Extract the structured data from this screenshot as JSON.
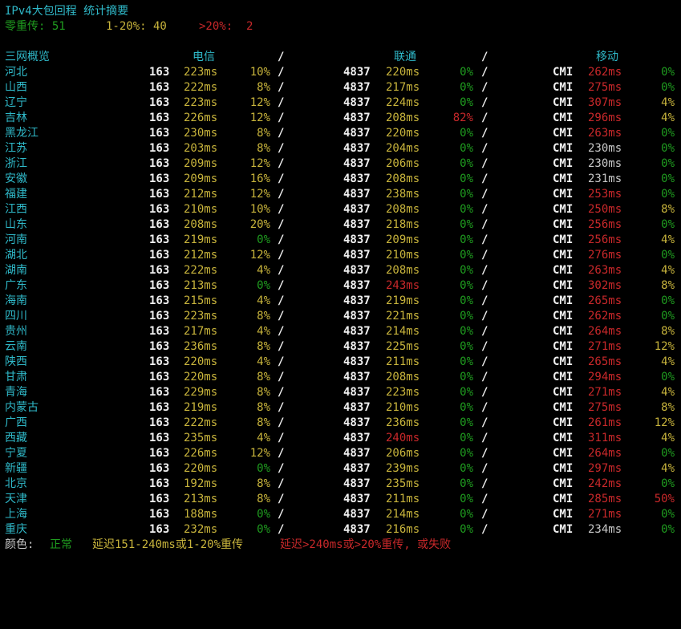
{
  "summary": {
    "title": "IPv4大包回程 统计摘要",
    "zero_label": "零重传: 51",
    "mid_label": "1-20%: 40",
    "high_label": ">20%:  2"
  },
  "header": {
    "overview": "三网概览",
    "telecom": "电信",
    "unicom": "联通",
    "mobile": "移动",
    "separator": "/"
  },
  "rows": [
    {
      "prov": "河北",
      "ct_asn": "163",
      "ct_lat": "223ms",
      "ct_lat_c": "y",
      "ct_loss": "10%",
      "ct_loss_c": "y",
      "cu_asn": "4837",
      "cu_lat": "220ms",
      "cu_lat_c": "y",
      "cu_loss": "0%",
      "cu_loss_c": "g",
      "cm_asn": "CMI",
      "cm_lat": "262ms",
      "cm_lat_c": "r",
      "cm_loss": "0%",
      "cm_loss_c": "g"
    },
    {
      "prov": "山西",
      "ct_asn": "163",
      "ct_lat": "222ms",
      "ct_lat_c": "y",
      "ct_loss": "8%",
      "ct_loss_c": "y",
      "cu_asn": "4837",
      "cu_lat": "217ms",
      "cu_lat_c": "y",
      "cu_loss": "0%",
      "cu_loss_c": "g",
      "cm_asn": "CMI",
      "cm_lat": "275ms",
      "cm_lat_c": "r",
      "cm_loss": "0%",
      "cm_loss_c": "g"
    },
    {
      "prov": "辽宁",
      "ct_asn": "163",
      "ct_lat": "223ms",
      "ct_lat_c": "y",
      "ct_loss": "12%",
      "ct_loss_c": "y",
      "cu_asn": "4837",
      "cu_lat": "224ms",
      "cu_lat_c": "y",
      "cu_loss": "0%",
      "cu_loss_c": "g",
      "cm_asn": "CMI",
      "cm_lat": "307ms",
      "cm_lat_c": "r",
      "cm_loss": "4%",
      "cm_loss_c": "y"
    },
    {
      "prov": "吉林",
      "ct_asn": "163",
      "ct_lat": "226ms",
      "ct_lat_c": "y",
      "ct_loss": "12%",
      "ct_loss_c": "y",
      "cu_asn": "4837",
      "cu_lat": "208ms",
      "cu_lat_c": "y",
      "cu_loss": "82%",
      "cu_loss_c": "r",
      "cm_asn": "CMI",
      "cm_lat": "296ms",
      "cm_lat_c": "r",
      "cm_loss": "4%",
      "cm_loss_c": "y"
    },
    {
      "prov": "黑龙江",
      "ct_asn": "163",
      "ct_lat": "230ms",
      "ct_lat_c": "y",
      "ct_loss": "8%",
      "ct_loss_c": "y",
      "cu_asn": "4837",
      "cu_lat": "220ms",
      "cu_lat_c": "y",
      "cu_loss": "0%",
      "cu_loss_c": "g",
      "cm_asn": "CMI",
      "cm_lat": "263ms",
      "cm_lat_c": "r",
      "cm_loss": "0%",
      "cm_loss_c": "g"
    },
    {
      "prov": "江苏",
      "ct_asn": "163",
      "ct_lat": "203ms",
      "ct_lat_c": "y",
      "ct_loss": "8%",
      "ct_loss_c": "y",
      "cu_asn": "4837",
      "cu_lat": "204ms",
      "cu_lat_c": "y",
      "cu_loss": "0%",
      "cu_loss_c": "g",
      "cm_asn": "CMI",
      "cm_lat": "230ms",
      "cm_lat_c": "p",
      "cm_loss": "0%",
      "cm_loss_c": "g"
    },
    {
      "prov": "浙江",
      "ct_asn": "163",
      "ct_lat": "209ms",
      "ct_lat_c": "y",
      "ct_loss": "12%",
      "ct_loss_c": "y",
      "cu_asn": "4837",
      "cu_lat": "206ms",
      "cu_lat_c": "y",
      "cu_loss": "0%",
      "cu_loss_c": "g",
      "cm_asn": "CMI",
      "cm_lat": "230ms",
      "cm_lat_c": "p",
      "cm_loss": "0%",
      "cm_loss_c": "g"
    },
    {
      "prov": "安徽",
      "ct_asn": "163",
      "ct_lat": "209ms",
      "ct_lat_c": "y",
      "ct_loss": "16%",
      "ct_loss_c": "y",
      "cu_asn": "4837",
      "cu_lat": "208ms",
      "cu_lat_c": "y",
      "cu_loss": "0%",
      "cu_loss_c": "g",
      "cm_asn": "CMI",
      "cm_lat": "231ms",
      "cm_lat_c": "p",
      "cm_loss": "0%",
      "cm_loss_c": "g"
    },
    {
      "prov": "福建",
      "ct_asn": "163",
      "ct_lat": "212ms",
      "ct_lat_c": "y",
      "ct_loss": "12%",
      "ct_loss_c": "y",
      "cu_asn": "4837",
      "cu_lat": "238ms",
      "cu_lat_c": "y",
      "cu_loss": "0%",
      "cu_loss_c": "g",
      "cm_asn": "CMI",
      "cm_lat": "253ms",
      "cm_lat_c": "r",
      "cm_loss": "0%",
      "cm_loss_c": "g"
    },
    {
      "prov": "江西",
      "ct_asn": "163",
      "ct_lat": "210ms",
      "ct_lat_c": "y",
      "ct_loss": "10%",
      "ct_loss_c": "y",
      "cu_asn": "4837",
      "cu_lat": "208ms",
      "cu_lat_c": "y",
      "cu_loss": "0%",
      "cu_loss_c": "g",
      "cm_asn": "CMI",
      "cm_lat": "250ms",
      "cm_lat_c": "r",
      "cm_loss": "8%",
      "cm_loss_c": "y"
    },
    {
      "prov": "山东",
      "ct_asn": "163",
      "ct_lat": "208ms",
      "ct_lat_c": "y",
      "ct_loss": "20%",
      "ct_loss_c": "y",
      "cu_asn": "4837",
      "cu_lat": "218ms",
      "cu_lat_c": "y",
      "cu_loss": "0%",
      "cu_loss_c": "g",
      "cm_asn": "CMI",
      "cm_lat": "256ms",
      "cm_lat_c": "r",
      "cm_loss": "0%",
      "cm_loss_c": "g"
    },
    {
      "prov": "河南",
      "ct_asn": "163",
      "ct_lat": "219ms",
      "ct_lat_c": "y",
      "ct_loss": "0%",
      "ct_loss_c": "g",
      "cu_asn": "4837",
      "cu_lat": "209ms",
      "cu_lat_c": "y",
      "cu_loss": "0%",
      "cu_loss_c": "g",
      "cm_asn": "CMI",
      "cm_lat": "256ms",
      "cm_lat_c": "r",
      "cm_loss": "4%",
      "cm_loss_c": "y"
    },
    {
      "prov": "湖北",
      "ct_asn": "163",
      "ct_lat": "212ms",
      "ct_lat_c": "y",
      "ct_loss": "12%",
      "ct_loss_c": "y",
      "cu_asn": "4837",
      "cu_lat": "210ms",
      "cu_lat_c": "y",
      "cu_loss": "0%",
      "cu_loss_c": "g",
      "cm_asn": "CMI",
      "cm_lat": "276ms",
      "cm_lat_c": "r",
      "cm_loss": "0%",
      "cm_loss_c": "g"
    },
    {
      "prov": "湖南",
      "ct_asn": "163",
      "ct_lat": "222ms",
      "ct_lat_c": "y",
      "ct_loss": "4%",
      "ct_loss_c": "y",
      "cu_asn": "4837",
      "cu_lat": "208ms",
      "cu_lat_c": "y",
      "cu_loss": "0%",
      "cu_loss_c": "g",
      "cm_asn": "CMI",
      "cm_lat": "263ms",
      "cm_lat_c": "r",
      "cm_loss": "4%",
      "cm_loss_c": "y"
    },
    {
      "prov": "广东",
      "ct_asn": "163",
      "ct_lat": "213ms",
      "ct_lat_c": "y",
      "ct_loss": "0%",
      "ct_loss_c": "g",
      "cu_asn": "4837",
      "cu_lat": "243ms",
      "cu_lat_c": "r",
      "cu_loss": "0%",
      "cu_loss_c": "g",
      "cm_asn": "CMI",
      "cm_lat": "302ms",
      "cm_lat_c": "r",
      "cm_loss": "8%",
      "cm_loss_c": "y"
    },
    {
      "prov": "海南",
      "ct_asn": "163",
      "ct_lat": "215ms",
      "ct_lat_c": "y",
      "ct_loss": "4%",
      "ct_loss_c": "y",
      "cu_asn": "4837",
      "cu_lat": "219ms",
      "cu_lat_c": "y",
      "cu_loss": "0%",
      "cu_loss_c": "g",
      "cm_asn": "CMI",
      "cm_lat": "265ms",
      "cm_lat_c": "r",
      "cm_loss": "0%",
      "cm_loss_c": "g"
    },
    {
      "prov": "四川",
      "ct_asn": "163",
      "ct_lat": "223ms",
      "ct_lat_c": "y",
      "ct_loss": "8%",
      "ct_loss_c": "y",
      "cu_asn": "4837",
      "cu_lat": "221ms",
      "cu_lat_c": "y",
      "cu_loss": "0%",
      "cu_loss_c": "g",
      "cm_asn": "CMI",
      "cm_lat": "262ms",
      "cm_lat_c": "r",
      "cm_loss": "0%",
      "cm_loss_c": "g"
    },
    {
      "prov": "贵州",
      "ct_asn": "163",
      "ct_lat": "217ms",
      "ct_lat_c": "y",
      "ct_loss": "4%",
      "ct_loss_c": "y",
      "cu_asn": "4837",
      "cu_lat": "214ms",
      "cu_lat_c": "y",
      "cu_loss": "0%",
      "cu_loss_c": "g",
      "cm_asn": "CMI",
      "cm_lat": "264ms",
      "cm_lat_c": "r",
      "cm_loss": "8%",
      "cm_loss_c": "y"
    },
    {
      "prov": "云南",
      "ct_asn": "163",
      "ct_lat": "236ms",
      "ct_lat_c": "y",
      "ct_loss": "8%",
      "ct_loss_c": "y",
      "cu_asn": "4837",
      "cu_lat": "225ms",
      "cu_lat_c": "y",
      "cu_loss": "0%",
      "cu_loss_c": "g",
      "cm_asn": "CMI",
      "cm_lat": "271ms",
      "cm_lat_c": "r",
      "cm_loss": "12%",
      "cm_loss_c": "y"
    },
    {
      "prov": "陕西",
      "ct_asn": "163",
      "ct_lat": "220ms",
      "ct_lat_c": "y",
      "ct_loss": "4%",
      "ct_loss_c": "y",
      "cu_asn": "4837",
      "cu_lat": "211ms",
      "cu_lat_c": "y",
      "cu_loss": "0%",
      "cu_loss_c": "g",
      "cm_asn": "CMI",
      "cm_lat": "265ms",
      "cm_lat_c": "r",
      "cm_loss": "4%",
      "cm_loss_c": "y"
    },
    {
      "prov": "甘肃",
      "ct_asn": "163",
      "ct_lat": "220ms",
      "ct_lat_c": "y",
      "ct_loss": "8%",
      "ct_loss_c": "y",
      "cu_asn": "4837",
      "cu_lat": "208ms",
      "cu_lat_c": "y",
      "cu_loss": "0%",
      "cu_loss_c": "g",
      "cm_asn": "CMI",
      "cm_lat": "294ms",
      "cm_lat_c": "r",
      "cm_loss": "0%",
      "cm_loss_c": "g"
    },
    {
      "prov": "青海",
      "ct_asn": "163",
      "ct_lat": "229ms",
      "ct_lat_c": "y",
      "ct_loss": "8%",
      "ct_loss_c": "y",
      "cu_asn": "4837",
      "cu_lat": "223ms",
      "cu_lat_c": "y",
      "cu_loss": "0%",
      "cu_loss_c": "g",
      "cm_asn": "CMI",
      "cm_lat": "271ms",
      "cm_lat_c": "r",
      "cm_loss": "4%",
      "cm_loss_c": "y"
    },
    {
      "prov": "内蒙古",
      "ct_asn": "163",
      "ct_lat": "219ms",
      "ct_lat_c": "y",
      "ct_loss": "8%",
      "ct_loss_c": "y",
      "cu_asn": "4837",
      "cu_lat": "210ms",
      "cu_lat_c": "y",
      "cu_loss": "0%",
      "cu_loss_c": "g",
      "cm_asn": "CMI",
      "cm_lat": "275ms",
      "cm_lat_c": "r",
      "cm_loss": "8%",
      "cm_loss_c": "y"
    },
    {
      "prov": "广西",
      "ct_asn": "163",
      "ct_lat": "222ms",
      "ct_lat_c": "y",
      "ct_loss": "8%",
      "ct_loss_c": "y",
      "cu_asn": "4837",
      "cu_lat": "236ms",
      "cu_lat_c": "y",
      "cu_loss": "0%",
      "cu_loss_c": "g",
      "cm_asn": "CMI",
      "cm_lat": "261ms",
      "cm_lat_c": "r",
      "cm_loss": "12%",
      "cm_loss_c": "y"
    },
    {
      "prov": "西藏",
      "ct_asn": "163",
      "ct_lat": "235ms",
      "ct_lat_c": "y",
      "ct_loss": "4%",
      "ct_loss_c": "y",
      "cu_asn": "4837",
      "cu_lat": "240ms",
      "cu_lat_c": "r",
      "cu_loss": "0%",
      "cu_loss_c": "g",
      "cm_asn": "CMI",
      "cm_lat": "311ms",
      "cm_lat_c": "r",
      "cm_loss": "4%",
      "cm_loss_c": "y"
    },
    {
      "prov": "宁夏",
      "ct_asn": "163",
      "ct_lat": "226ms",
      "ct_lat_c": "y",
      "ct_loss": "12%",
      "ct_loss_c": "y",
      "cu_asn": "4837",
      "cu_lat": "206ms",
      "cu_lat_c": "y",
      "cu_loss": "0%",
      "cu_loss_c": "g",
      "cm_asn": "CMI",
      "cm_lat": "264ms",
      "cm_lat_c": "r",
      "cm_loss": "0%",
      "cm_loss_c": "g"
    },
    {
      "prov": "新疆",
      "ct_asn": "163",
      "ct_lat": "220ms",
      "ct_lat_c": "y",
      "ct_loss": "0%",
      "ct_loss_c": "g",
      "cu_asn": "4837",
      "cu_lat": "239ms",
      "cu_lat_c": "y",
      "cu_loss": "0%",
      "cu_loss_c": "g",
      "cm_asn": "CMI",
      "cm_lat": "297ms",
      "cm_lat_c": "r",
      "cm_loss": "4%",
      "cm_loss_c": "y"
    },
    {
      "prov": "北京",
      "ct_asn": "163",
      "ct_lat": "192ms",
      "ct_lat_c": "y",
      "ct_loss": "8%",
      "ct_loss_c": "y",
      "cu_asn": "4837",
      "cu_lat": "235ms",
      "cu_lat_c": "y",
      "cu_loss": "0%",
      "cu_loss_c": "g",
      "cm_asn": "CMI",
      "cm_lat": "242ms",
      "cm_lat_c": "r",
      "cm_loss": "0%",
      "cm_loss_c": "g"
    },
    {
      "prov": "天津",
      "ct_asn": "163",
      "ct_lat": "213ms",
      "ct_lat_c": "y",
      "ct_loss": "8%",
      "ct_loss_c": "y",
      "cu_asn": "4837",
      "cu_lat": "211ms",
      "cu_lat_c": "y",
      "cu_loss": "0%",
      "cu_loss_c": "g",
      "cm_asn": "CMI",
      "cm_lat": "285ms",
      "cm_lat_c": "r",
      "cm_loss": "50%",
      "cm_loss_c": "r"
    },
    {
      "prov": "上海",
      "ct_asn": "163",
      "ct_lat": "188ms",
      "ct_lat_c": "y",
      "ct_loss": "0%",
      "ct_loss_c": "g",
      "cu_asn": "4837",
      "cu_lat": "214ms",
      "cu_lat_c": "y",
      "cu_loss": "0%",
      "cu_loss_c": "g",
      "cm_asn": "CMI",
      "cm_lat": "271ms",
      "cm_lat_c": "r",
      "cm_loss": "0%",
      "cm_loss_c": "g"
    },
    {
      "prov": "重庆",
      "ct_asn": "163",
      "ct_lat": "232ms",
      "ct_lat_c": "y",
      "ct_loss": "0%",
      "ct_loss_c": "g",
      "cu_asn": "4837",
      "cu_lat": "216ms",
      "cu_lat_c": "y",
      "cu_loss": "0%",
      "cu_loss_c": "g",
      "cm_asn": "CMI",
      "cm_lat": "234ms",
      "cm_lat_c": "p",
      "cm_loss": "0%",
      "cm_loss_c": "g"
    }
  ],
  "legend": {
    "label": "颜色: ",
    "normal": "正常",
    "mid": "延迟151-240ms或1-20%重传",
    "bad": "延迟>240ms或>20%重传, 或失败"
  },
  "colors": {
    "cyan": "#2fb8c8",
    "green": "#1f9c1f",
    "yellow": "#c8b43c",
    "red": "#c8282a",
    "white": "#f0f0f0",
    "background": "#000000"
  }
}
